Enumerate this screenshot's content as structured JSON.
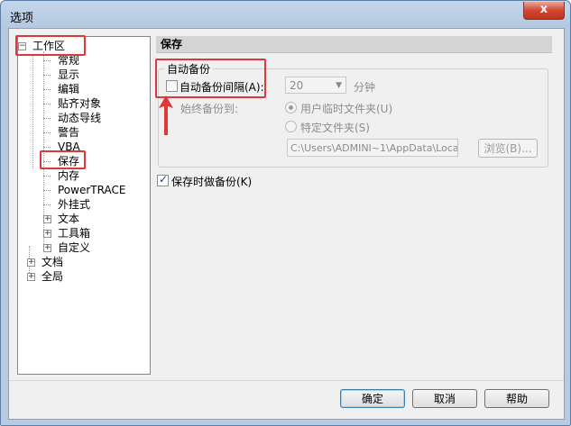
{
  "window": {
    "title": "选项",
    "close_glyph": "x"
  },
  "tree": {
    "nodes": [
      {
        "label": "工作区",
        "expander": "−"
      },
      {
        "label": "常规"
      },
      {
        "label": "显示"
      },
      {
        "label": "编辑"
      },
      {
        "label": "贴齐对象"
      },
      {
        "label": "动态导线"
      },
      {
        "label": "警告"
      },
      {
        "label": "VBA"
      },
      {
        "label": "保存"
      },
      {
        "label": "内存"
      },
      {
        "label": "PowerTRACE"
      },
      {
        "label": "外挂式"
      },
      {
        "label": "文本",
        "expander": "+"
      },
      {
        "label": "工具箱",
        "expander": "+"
      },
      {
        "label": "自定义",
        "expander": "+"
      },
      {
        "label": "文档",
        "expander": "+"
      },
      {
        "label": "全局",
        "expander": "+"
      }
    ]
  },
  "panel": {
    "title": "保存",
    "group_label": "自动备份",
    "auto_backup_label": "自动备份间隔(A):",
    "interval_value": "20",
    "interval_unit": "分钟",
    "always_backup_label": "始终备份到:",
    "radio_temp": "用户临时文件夹(U)",
    "radio_specific": "特定文件夹(S)",
    "path_value": "C:\\Users\\ADMINI~1\\AppData\\Local\\Te",
    "browse_label": "浏览(B)...",
    "save_backup_label": "保存时做备份(K)"
  },
  "buttons": {
    "ok": "确定",
    "cancel": "取消",
    "help": "帮助"
  },
  "icons": {
    "checkmark": "✓",
    "dropdown": "▼"
  },
  "colors": {
    "highlight": "#e03838",
    "title_bar": "#c4d6ea"
  }
}
